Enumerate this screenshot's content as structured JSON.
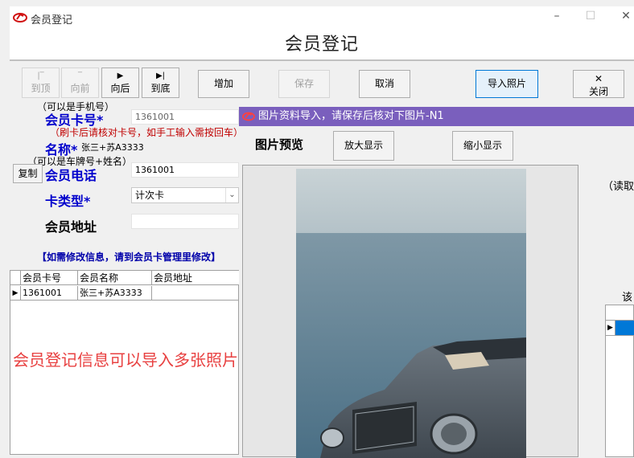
{
  "window": {
    "title": "会员登记",
    "minimize": "–",
    "maximize": "☐",
    "close": "✕"
  },
  "header": {
    "title": "会员登记"
  },
  "toolbar": {
    "first": {
      "label": "到顶",
      "arrow": "|‾"
    },
    "prev": {
      "label": "向前",
      "arrow": "‾"
    },
    "next": {
      "label": "向后",
      "arrow": "▶"
    },
    "last": {
      "label": "到底",
      "arrow": "▶|"
    },
    "add": "增加",
    "save": "保存",
    "cancel": "取消",
    "import_photo": "导入照片",
    "close": {
      "label": "关闭",
      "icon": "✕"
    }
  },
  "form": {
    "card_hint": "（可以是手机号）",
    "card_label": "会员卡号",
    "card_value": "1361001",
    "card_red_hint": "（刷卡后请核对卡号，如手工输入需按回车）",
    "name_label": "名称",
    "name_value": "张三+苏A3333",
    "name_hint": "（可以是车牌号+姓名）",
    "copy_button": "复制",
    "phone_label": "会员电话",
    "phone_value": "1361001",
    "card_type_label": "卡类型",
    "card_type_value": "计次卡",
    "address_label": "会员地址",
    "address_value": "",
    "star": "*",
    "notice": "【如需修改信息，请到会员卡管理里修改】"
  },
  "table": {
    "columns": [
      "会员卡号",
      "会员名称",
      "会员地址"
    ],
    "rows": [
      {
        "card": "1361001",
        "name": "张三+苏A3333",
        "address": ""
      }
    ]
  },
  "overlay_caption": "会员登记信息可以导入多张照片",
  "dialog": {
    "title": "图片资料导入，请保存后核对下图片-N1",
    "preview_label": "图片预览",
    "zoom_in": "放大显示",
    "zoom_out": "缩小显示",
    "right_text_1": "（读取",
    "right_text_2": "该"
  },
  "colors": {
    "dialog_title_bg": "#7a5fbd",
    "label_blue": "#0000cc",
    "hint_red": "#c00000",
    "caption_red": "#e84040",
    "selection_blue": "#0078d7"
  }
}
